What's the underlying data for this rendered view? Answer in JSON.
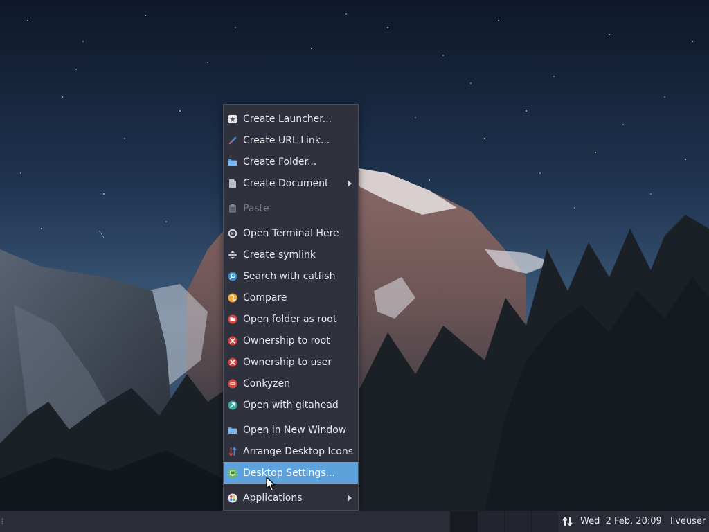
{
  "context_menu": {
    "items": [
      {
        "label": "Create Launcher...",
        "icon": "launcher-icon"
      },
      {
        "label": "Create URL Link...",
        "icon": "url-link-icon"
      },
      {
        "label": "Create Folder...",
        "icon": "folder-icon"
      },
      {
        "label": "Create Document",
        "icon": "document-icon",
        "submenu": true
      },
      {
        "label": "Paste",
        "icon": "paste-icon",
        "disabled": true
      },
      {
        "label": "Open Terminal Here",
        "icon": "terminal-icon"
      },
      {
        "label": "Create symlink",
        "icon": "symlink-icon"
      },
      {
        "label": "Search with catfish",
        "icon": "catfish-search-icon"
      },
      {
        "label": "Compare",
        "icon": "compare-icon"
      },
      {
        "label": "Open folder as root",
        "icon": "root-folder-icon"
      },
      {
        "label": "Ownership to root",
        "icon": "ownership-root-icon"
      },
      {
        "label": "Ownership to user",
        "icon": "ownership-user-icon"
      },
      {
        "label": "Conkyzen",
        "icon": "conkyzen-icon"
      },
      {
        "label": "Open with gitahead",
        "icon": "gitahead-icon"
      },
      {
        "label": "Open in New Window",
        "icon": "new-window-folder-icon"
      },
      {
        "label": "Arrange Desktop Icons",
        "icon": "arrange-icons-icon"
      },
      {
        "label": "Desktop Settings...",
        "icon": "desktop-settings-icon",
        "active": true
      },
      {
        "label": "Applications",
        "icon": "applications-icon",
        "submenu": true
      }
    ]
  },
  "taskbar": {
    "clock": "Wed  2 Feb, 20:09",
    "user": "liveuser",
    "workspace_count": 4,
    "current_workspace": 1
  },
  "colors": {
    "menu_background": "#2f313c",
    "menu_highlight": "#5ea2dc",
    "taskbar_background": "#2a2c36"
  }
}
